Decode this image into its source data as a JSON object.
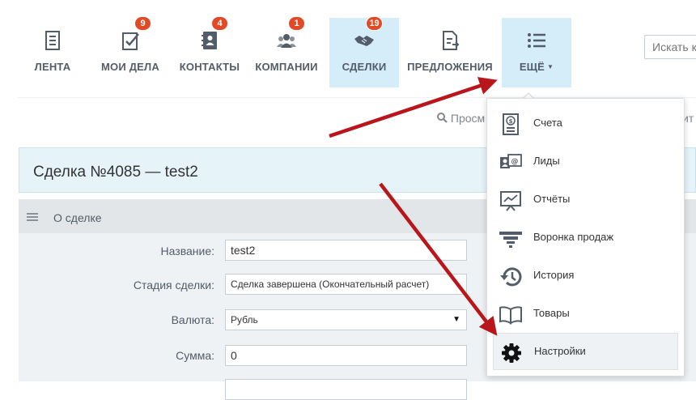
{
  "nav": {
    "items": [
      {
        "label": "ЛЕНТА",
        "badge": ""
      },
      {
        "label": "МОИ ДЕЛА",
        "badge": "9"
      },
      {
        "label": "КОНТАКТЫ",
        "badge": "4"
      },
      {
        "label": "КОМПАНИИ",
        "badge": "1"
      },
      {
        "label": "СДЕЛКИ",
        "badge": "19"
      },
      {
        "label": "ПРЕДЛОЖЕНИЯ",
        "badge": ""
      },
      {
        "label": "ЕЩЁ",
        "badge": ""
      }
    ],
    "search_placeholder": "Искать клиента"
  },
  "subbar": {
    "search_text": "Просм",
    "right_text": "ит"
  },
  "deal": {
    "title": "Сделка №4085 — test2",
    "section_title": "О сделке",
    "fields": [
      {
        "label": "Название:",
        "value": "test2"
      },
      {
        "label": "Стадия сделки:",
        "value": "Сделка завершена (Окончательный расчет)"
      },
      {
        "label": "Валюта:",
        "value": "Рубль"
      },
      {
        "label": "Сумма:",
        "value": "0"
      }
    ]
  },
  "dropdown": {
    "items": [
      {
        "label": "Счета",
        "icon": "invoice-icon"
      },
      {
        "label": "Лиды",
        "icon": "leads-icon"
      },
      {
        "label": "Отчёты",
        "icon": "reports-icon"
      },
      {
        "label": "Воронка продаж",
        "icon": "funnel-icon"
      },
      {
        "label": "История",
        "icon": "history-icon"
      },
      {
        "label": "Товары",
        "icon": "products-icon"
      },
      {
        "label": "Настройки",
        "icon": "gear-icon"
      }
    ]
  },
  "colors": {
    "active_tab_bg": "#d4edf9",
    "badge_red": "#e24a26",
    "arrow_red": "#b8161b",
    "nav_text": "#535c69"
  }
}
